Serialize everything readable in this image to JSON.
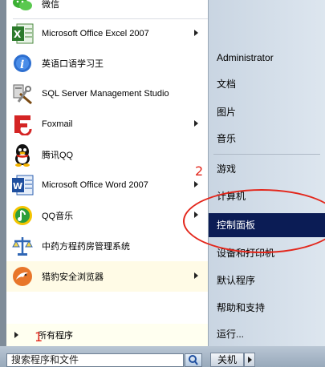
{
  "left_items": [
    {
      "label": "微信",
      "icon": "wechat-icon",
      "arrow": false
    },
    {
      "label": "Microsoft Office Excel 2007",
      "icon": "excel-icon",
      "arrow": true
    },
    {
      "label": "英语口语学习王",
      "icon": "info-icon",
      "arrow": false
    },
    {
      "label": "SQL Server Management Studio",
      "icon": "sql-server-icon",
      "arrow": false
    },
    {
      "label": "Foxmail",
      "icon": "foxmail-icon",
      "arrow": true
    },
    {
      "label": "腾讯QQ",
      "icon": "qq-penguin-icon",
      "arrow": false
    },
    {
      "label": "Microsoft Office Word 2007",
      "icon": "word-icon",
      "arrow": true
    },
    {
      "label": "QQ音乐",
      "icon": "qq-music-icon",
      "arrow": true
    },
    {
      "label": "中药方程药房管理系统",
      "icon": "scale-icon",
      "arrow": false
    },
    {
      "label": "猎豹安全浏览器",
      "icon": "cheetah-browser-icon",
      "arrow": true
    }
  ],
  "all_programs": {
    "label": "所有程序"
  },
  "search": {
    "placeholder": "搜索程序和文件"
  },
  "right_items": [
    {
      "label": "Administrator"
    },
    {
      "label": "文档"
    },
    {
      "label": "图片"
    },
    {
      "label": "音乐"
    },
    {
      "label": "游戏"
    },
    {
      "label": "计算机"
    },
    {
      "label": "控制面板"
    },
    {
      "label": "设备和打印机"
    },
    {
      "label": "默认程序"
    },
    {
      "label": "帮助和支持"
    },
    {
      "label": "运行..."
    }
  ],
  "shutdown": {
    "label": "关机"
  },
  "annotations": {
    "step1": "1",
    "step2": "2"
  },
  "colors": {
    "selected_bg": "#0b1c55",
    "annotation": "#e3261b"
  }
}
